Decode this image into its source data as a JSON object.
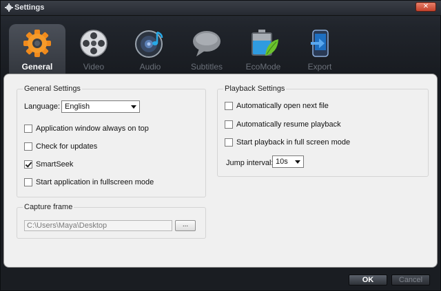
{
  "window": {
    "title": "Settings"
  },
  "tabs": [
    {
      "label": "General",
      "icon": "gear-icon",
      "active": true
    },
    {
      "label": "Video",
      "icon": "film-reel-icon",
      "active": false
    },
    {
      "label": "Audio",
      "icon": "speaker-note-icon",
      "active": false
    },
    {
      "label": "Subtitles",
      "icon": "speech-bubble-icon",
      "active": false
    },
    {
      "label": "EcoMode",
      "icon": "battery-leaf-icon",
      "active": false
    },
    {
      "label": "Export",
      "icon": "export-device-icon",
      "active": false
    }
  ],
  "general_settings": {
    "title": "General Settings",
    "language_label": "Language:",
    "language_value": "English",
    "options": [
      {
        "label": "Application window always on top",
        "checked": false
      },
      {
        "label": "Check for updates",
        "checked": false
      },
      {
        "label": "SmartSeek",
        "checked": true
      },
      {
        "label": "Start application in fullscreen mode",
        "checked": false
      }
    ]
  },
  "capture_frame": {
    "title": "Capture frame",
    "path_value": "C:\\Users\\Maya\\Desktop",
    "browse_label": "..."
  },
  "playback_settings": {
    "title": "Playback Settings",
    "options": [
      {
        "label": "Automatically open next file",
        "checked": false
      },
      {
        "label": "Automatically resume playback",
        "checked": false
      },
      {
        "label": "Start playback in full screen mode",
        "checked": false
      }
    ],
    "jump_interval_label": "Jump interval:",
    "jump_interval_value": "10s"
  },
  "footer": {
    "ok_label": "OK",
    "cancel_label": "Cancel"
  },
  "colors": {
    "accent_orange": "#f08a1c",
    "panel_bg": "#f0f0f0",
    "window_bg": "#1b1f25"
  }
}
